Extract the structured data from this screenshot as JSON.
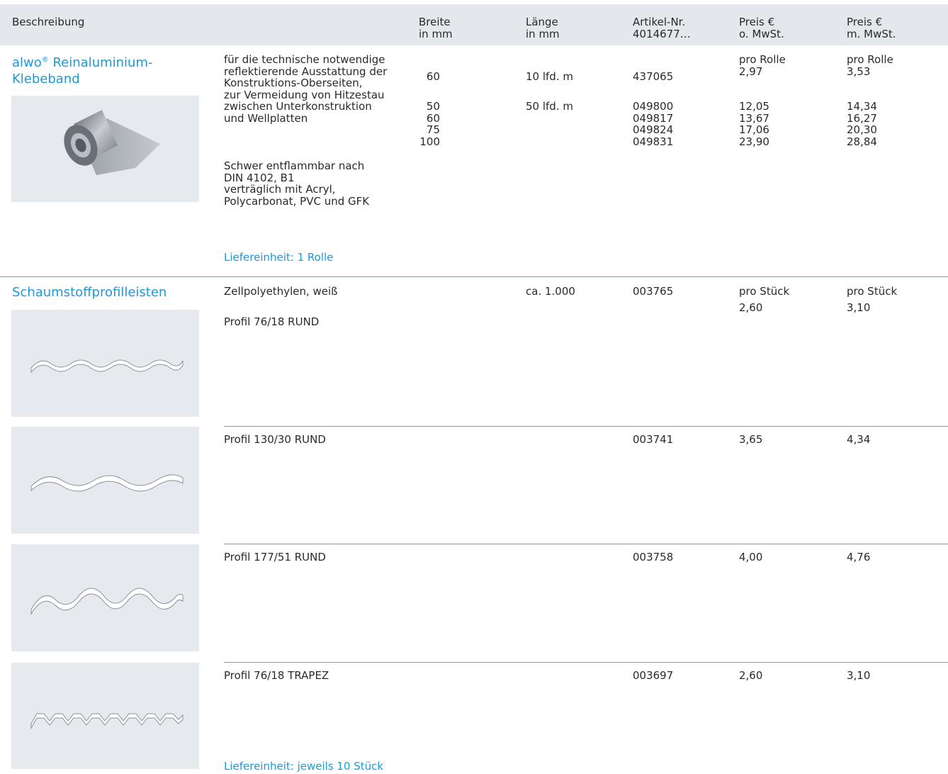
{
  "header": {
    "beschreibung": "Beschreibung",
    "breite": "Breite\nin mm",
    "laenge": "Länge\nin mm",
    "artikel": "Artikel-Nr.\n4014677…",
    "preis_o": "Preis €\no. MwSt.",
    "preis_m": "Preis €\nm. MwSt."
  },
  "section1": {
    "title_a": "alwo",
    "title_reg": "®",
    "title_b": " Reinaluminium-\nKlebeband",
    "image_icon": "aluminium-tape-roll",
    "description": "für die technische notwendige\nreflektierende Ausstattung der\nKonstruktions-Oberseiten,\nzur Vermeidung von Hitzestau\nzwischen Unterkonstruktion\nund Wellplatten",
    "description2": "Schwer entflammbar nach\nDIN 4102, B1\nverträglich mit Acryl,\nPolycarbonat, PVC und GFK",
    "breite_a": "60",
    "breite_b": "50\n60\n75\n100",
    "laenge_a": "10 lfd. m",
    "laenge_b": "50 lfd. m",
    "artikel_a": "437065",
    "artikel_b": "049800\n049817\n049824\n049831",
    "preis_o_a": "pro Rolle\n2,97",
    "preis_o_b": "12,05\n13,67\n17,06\n23,90",
    "preis_m_a": "pro Rolle\n3,53",
    "preis_m_b": "14,34\n16,27\n20,30\n28,84",
    "liefereinheit": "Liefereinheit: 1 Rolle"
  },
  "section2": {
    "title": "Schaumstoffprofilleisten",
    "material": "Zellpolyethylen, weiß",
    "laenge": "ca. 1.000",
    "preis_o_label": "pro Stück",
    "preis_m_label": "pro Stück",
    "rows": [
      {
        "profil": "Profil 76/18 RUND",
        "artikel": "003765",
        "preis_o": "2,60",
        "preis_m": "3,10",
        "icon": "round-profile-76-18"
      },
      {
        "profil": "Profil 130/30 RUND",
        "artikel": "003741",
        "preis_o": "3,65",
        "preis_m": "4,34",
        "icon": "round-profile-130-30"
      },
      {
        "profil": "Profil 177/51 RUND",
        "artikel": "003758",
        "preis_o": "4,00",
        "preis_m": "4,76",
        "icon": "round-profile-177-51"
      },
      {
        "profil": "Profil 76/18 TRAPEZ",
        "artikel": "003697",
        "preis_o": "2,60",
        "preis_m": "3,10",
        "icon": "trapez-profile-76-18"
      }
    ],
    "liefereinheit": "Liefereinheit: jeweils 10 Stück"
  }
}
